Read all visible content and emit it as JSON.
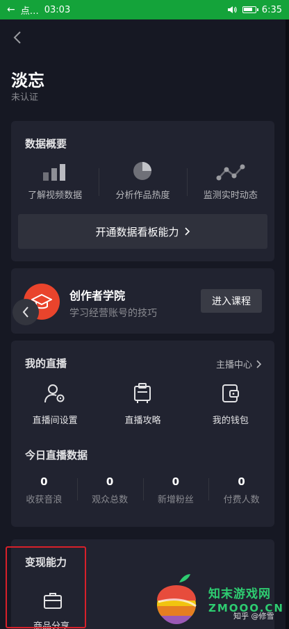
{
  "status_bar": {
    "left_text": "点…",
    "time": "03:03",
    "right_time": "6:35"
  },
  "profile": {
    "name": "淡忘",
    "verification": "未认证"
  },
  "data_overview": {
    "title": "数据概要",
    "tools": [
      {
        "label": "了解视频数据",
        "icon": "bar-chart-icon"
      },
      {
        "label": "分析作品热度",
        "icon": "pie-chart-icon"
      },
      {
        "label": "监测实时动态",
        "icon": "line-chart-icon"
      }
    ],
    "open_button": "开通数据看板能力"
  },
  "academy": {
    "title": "创作者学院",
    "subtitle": "学习经营账号的技巧",
    "button": "进入课程"
  },
  "live": {
    "title": "我的直播",
    "center_link": "主播中心",
    "actions": [
      {
        "label": "直播间设置",
        "icon": "user-settings-icon"
      },
      {
        "label": "直播攻略",
        "icon": "guide-icon"
      },
      {
        "label": "我的钱包",
        "icon": "wallet-icon"
      }
    ],
    "today_title": "今日直播数据",
    "stats": [
      {
        "value": "0",
        "label": "收获音浪"
      },
      {
        "value": "0",
        "label": "观众总数"
      },
      {
        "value": "0",
        "label": "新增粉丝"
      },
      {
        "value": "0",
        "label": "付费人数"
      }
    ]
  },
  "monetization": {
    "title": "变现能力",
    "item_label": "商品分享"
  },
  "watermark": {
    "site_name": "知末游戏网",
    "site_domain": "ZMOOO.CN",
    "zhihu_credit": "知乎 @修雪"
  },
  "colors": {
    "background": "#161823",
    "card": "#212330",
    "status_bar": "#14a33a",
    "academy_logo": "#e9442c",
    "highlight": "#d8202a"
  }
}
